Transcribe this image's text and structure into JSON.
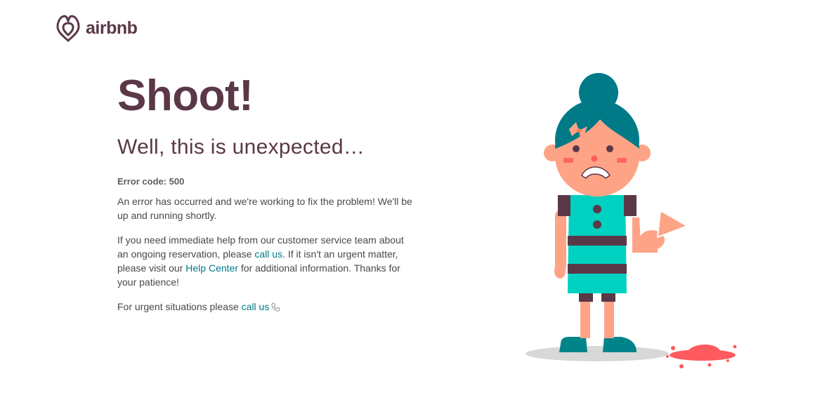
{
  "header": {
    "logo_text": "airbnb",
    "logo_icon": "airbnb-belo-icon"
  },
  "error": {
    "headline": "Shoot!",
    "subheadline": "Well, this is unexpected…",
    "code_text": "Error code: 500",
    "paragraph1": "An error has occurred and we're working to fix the problem! We'll be up and running shortly.",
    "paragraph2": {
      "part1": "If you need immediate help from our customer service team about an ongoing reservation, please ",
      "link1": "call us",
      "part2": ". If it isn't an urgent matter, please visit our ",
      "link2": "Help Center",
      "part3": " for additional information. Thanks for your patience!"
    },
    "paragraph3": {
      "text": "For urgent situations please ",
      "link": "call us",
      "icon": "phone-icon"
    }
  },
  "colors": {
    "brand_plum": "#5a3848",
    "link_teal": "#007a87",
    "body_text": "#484848",
    "dress": "#00d1c1",
    "hair": "#007a87",
    "ice_cream": "#ff5a5f"
  }
}
